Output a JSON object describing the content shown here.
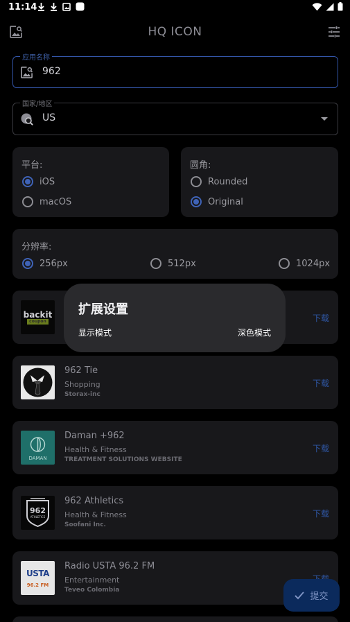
{
  "status": {
    "time": "11:14"
  },
  "appbar": {
    "title": "HQ ICON",
    "left_icon": "image-search-icon",
    "right_icon": "tune-icon"
  },
  "app_name_field": {
    "label": "应用名称",
    "value": "962"
  },
  "region_field": {
    "label": "国家/地区",
    "value": "US"
  },
  "platform": {
    "title": "平台:",
    "options": [
      "iOS",
      "macOS"
    ],
    "selected": "iOS"
  },
  "corner": {
    "title": "圆角:",
    "options": [
      "Rounded",
      "Original"
    ],
    "selected": "Original"
  },
  "resolution": {
    "title": "分辨率:",
    "options": [
      "256px",
      "512px",
      "1024px"
    ],
    "selected": "256px"
  },
  "apps": [
    {
      "name": "",
      "category": "",
      "developer": "",
      "download": "下载",
      "logo_text": "backit",
      "logo_sub": "coupon"
    },
    {
      "name": "962 Tie",
      "category": "Shopping",
      "developer": "Storax-inc",
      "download": "下载"
    },
    {
      "name": "Daman +962",
      "category": "Health & Fitness",
      "developer": "TREATMENT SOLUTIONS WEBSITE",
      "download": "下载",
      "logo_text": "DAMAN"
    },
    {
      "name": "962 Athletics",
      "category": "Health & Fitness",
      "developer": "Soofani Inc.",
      "download": "下载",
      "logo_text": "962",
      "logo_sub": "ATHLETICS"
    },
    {
      "name": "Radio USTA 96.2 FM",
      "category": "Entertainment",
      "developer": "Teveo Colombia",
      "download": "下载",
      "logo_text": "USTA",
      "logo_sub": "96.2 FM"
    }
  ],
  "dialog": {
    "title": "扩展设置",
    "left_label": "显示模式",
    "right_label": "深色模式"
  },
  "fab": {
    "label": "提交"
  },
  "colors": {
    "accent": "#3f63b7",
    "card": "#18181b",
    "dialog": "#2a2a2d",
    "fab": "#0b2a5c"
  }
}
